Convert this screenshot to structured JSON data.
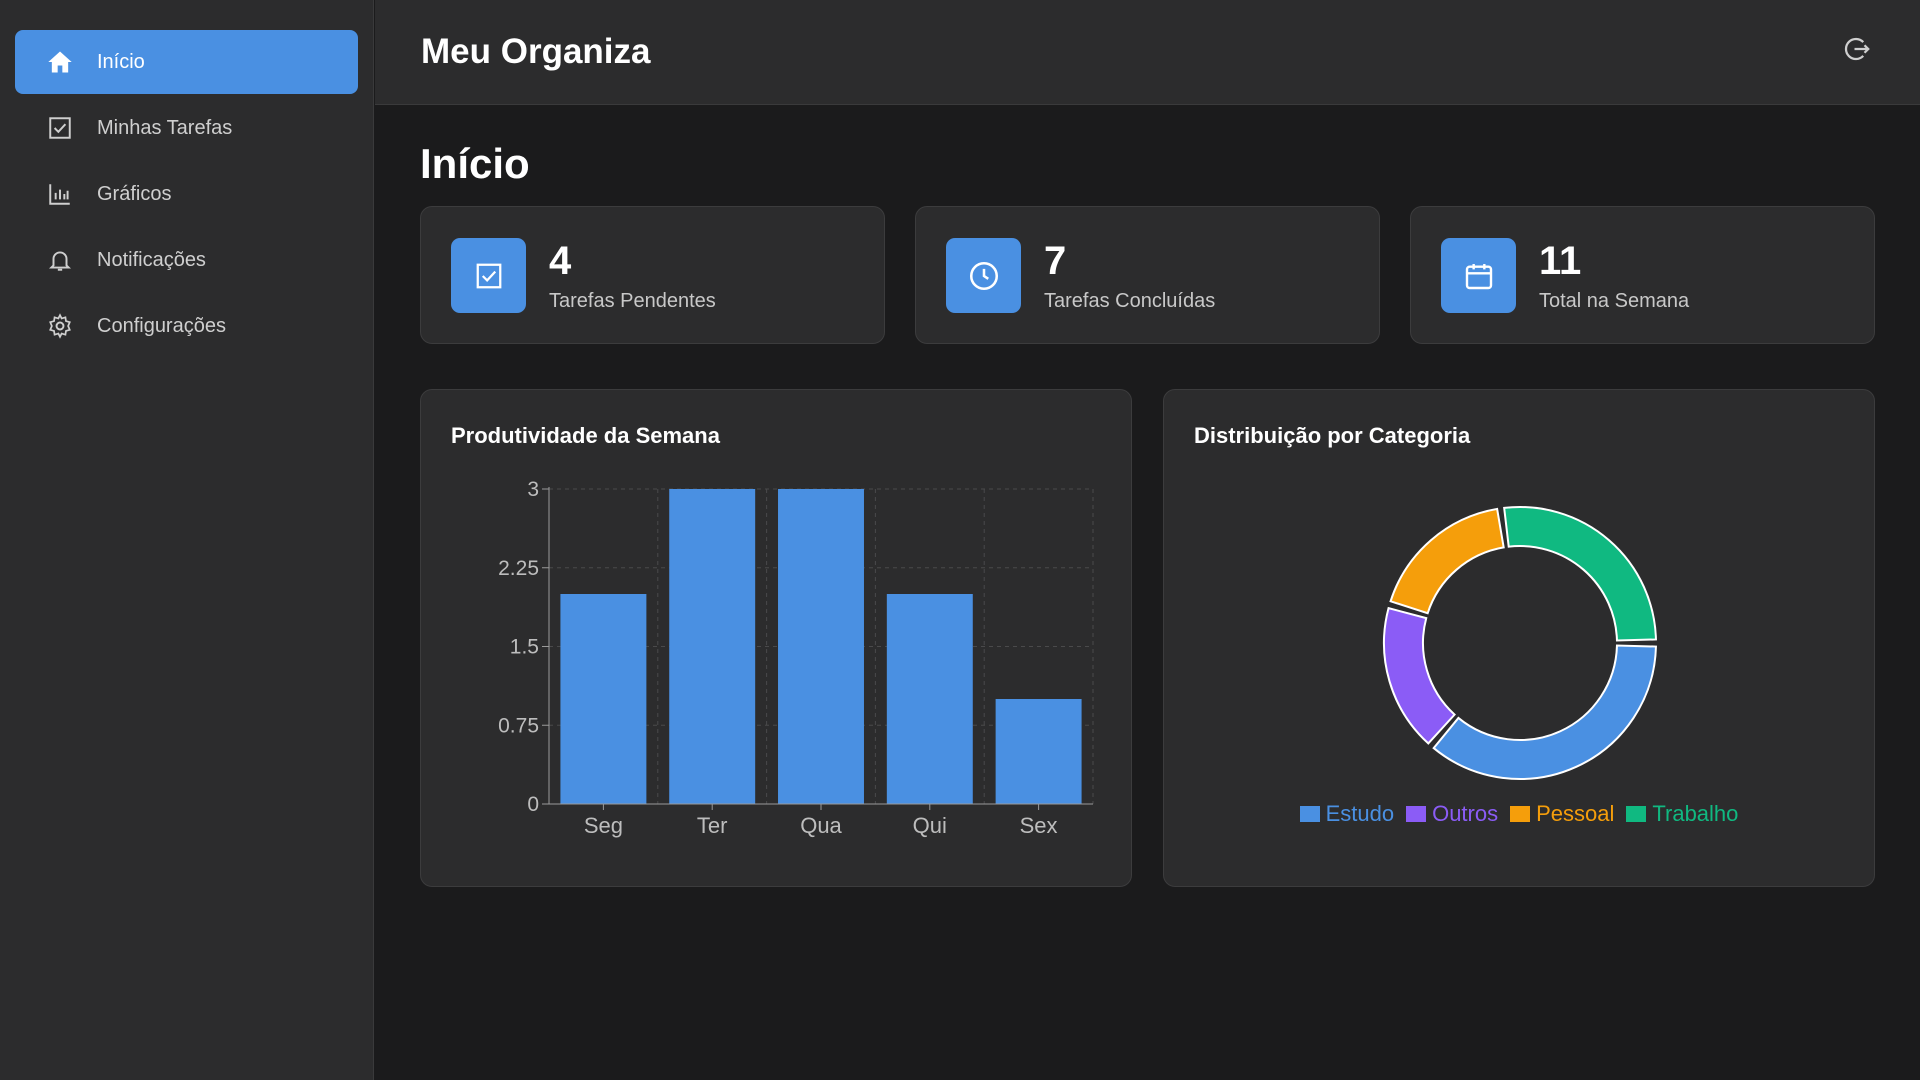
{
  "sidebar": {
    "items": [
      {
        "label": "Início",
        "icon": "home-icon",
        "active": true
      },
      {
        "label": "Minhas Tarefas",
        "icon": "checkbox-icon",
        "active": false
      },
      {
        "label": "Gráficos",
        "icon": "bar-chart-icon",
        "active": false
      },
      {
        "label": "Notificações",
        "icon": "bell-icon",
        "active": false
      },
      {
        "label": "Configurações",
        "icon": "gear-icon",
        "active": false
      }
    ]
  },
  "header": {
    "title": "Meu Organiza",
    "logout_icon": "logout-icon"
  },
  "main": {
    "title": "Início",
    "stats": [
      {
        "value": "4",
        "label": "Tarefas Pendentes",
        "icon": "checkbox-icon"
      },
      {
        "value": "7",
        "label": "Tarefas Concluídas",
        "icon": "clock-icon"
      },
      {
        "value": "11",
        "label": "Total na Semana",
        "icon": "calendar-icon"
      }
    ],
    "panels": {
      "productivity_title": "Produtividade da Semana",
      "distribution_title": "Distribuição por Categoria"
    }
  },
  "colors": {
    "accent": "#4a90e2",
    "estudo": "#4a90e2",
    "outros": "#8b5cf6",
    "pessoal": "#f59e0b",
    "trabalho": "#10b981"
  },
  "chart_data": [
    {
      "type": "bar",
      "title": "Produtividade da Semana",
      "categories": [
        "Seg",
        "Ter",
        "Qua",
        "Qui",
        "Sex"
      ],
      "values": [
        2,
        3,
        3,
        2,
        1
      ],
      "ylim": [
        0,
        3
      ],
      "yticks": [
        "0",
        "0.75",
        "1.5",
        "2.25",
        "3"
      ],
      "grid": true
    },
    {
      "type": "pie",
      "title": "Distribuição por Categoria",
      "donut": true,
      "slices": [
        {
          "name": "Estudo",
          "value": 4,
          "color": "#4a90e2"
        },
        {
          "name": "Outros",
          "value": 2,
          "color": "#8b5cf6"
        },
        {
          "name": "Pessoal",
          "value": 2,
          "color": "#f59e0b"
        },
        {
          "name": "Trabalho",
          "value": 3,
          "color": "#10b981"
        }
      ],
      "legend": "bottom"
    }
  ]
}
